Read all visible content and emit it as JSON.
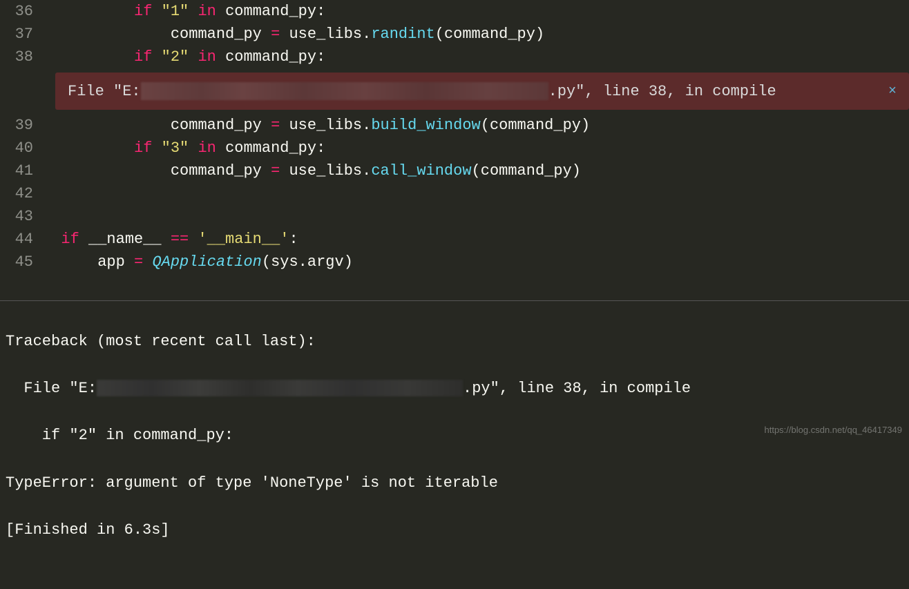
{
  "lines": {
    "36": {
      "num": "36"
    },
    "37": {
      "num": "37"
    },
    "38": {
      "num": "38"
    },
    "39": {
      "num": "39"
    },
    "40": {
      "num": "40"
    },
    "41": {
      "num": "41"
    },
    "42": {
      "num": "42"
    },
    "43": {
      "num": "43"
    },
    "44": {
      "num": "44"
    },
    "45": {
      "num": "45"
    }
  },
  "code": {
    "if_kw": "if",
    "in_kw": "in",
    "eq_op": "==",
    "assign_op": "=",
    "str_1": "\"1\"",
    "str_2": "\"2\"",
    "str_3": "\"3\"",
    "command_py": "command_py",
    "colon": ":",
    "use_libs": "use_libs",
    "dot": ".",
    "randint": "randint",
    "build_window": "build_window",
    "call_window": "call_window",
    "lparen": "(",
    "rparen": ")",
    "name_dunder": "__name__",
    "main_str": "'__main__'",
    "app": "app",
    "QApplication": "QApplication",
    "sys_argv": "sys.argv"
  },
  "error": {
    "file_prefix": "File \"E:",
    "file_suffix": ".py\", line 38, in compile",
    "close_glyph": "×"
  },
  "console": {
    "l1": "Traceback (most recent call last):",
    "l2a": "  File \"E:",
    "l2b": ".py\", line 38, in compile",
    "l3": "    if \"2\" in command_py:",
    "l4": "TypeError: argument of type 'NoneType' is not iterable",
    "l5": "[Finished in 6.3s]"
  },
  "watermark": "https://blog.csdn.net/qq_46417349"
}
